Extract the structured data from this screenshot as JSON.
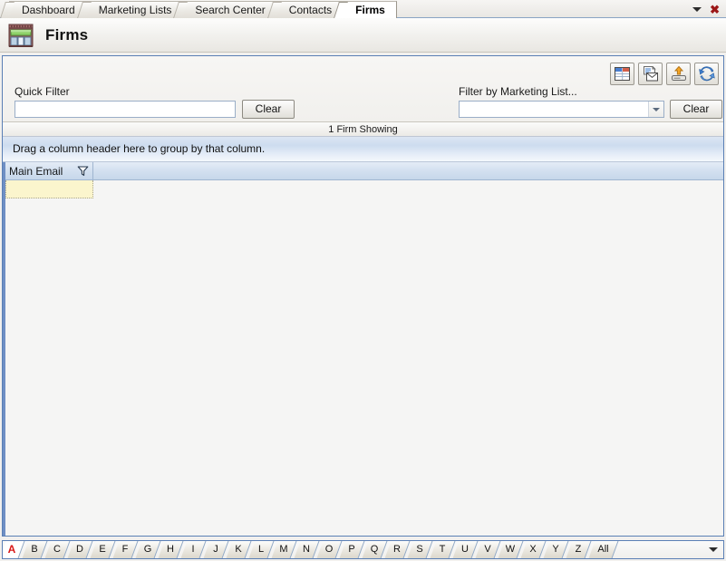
{
  "window": {
    "tabs": [
      {
        "label": "Dashboard",
        "active": false
      },
      {
        "label": "Marketing Lists",
        "active": false
      },
      {
        "label": "Search Center",
        "active": false
      },
      {
        "label": "Contacts",
        "active": false
      },
      {
        "label": "Firms",
        "active": true
      }
    ],
    "tabstrip_menu_icon": "chevron-down-icon",
    "close_icon": "close-icon",
    "close_glyph": "✖"
  },
  "header": {
    "icon": "storefront-icon",
    "title": "Firms"
  },
  "filters": {
    "quick_filter": {
      "label": "Quick Filter",
      "value": "",
      "placeholder": "",
      "clear_label": "Clear"
    },
    "marketing_list": {
      "label": "Filter by Marketing List...",
      "value": "",
      "placeholder": "",
      "clear_label": "Clear",
      "dropdown_icon": "chevron-down-icon"
    }
  },
  "toolbar": {
    "buttons": [
      {
        "name": "grid-view-button",
        "icon": "grid-table-icon"
      },
      {
        "name": "mail-merge-button",
        "icon": "document-envelope-icon"
      },
      {
        "name": "export-button",
        "icon": "upload-arrow-icon"
      },
      {
        "name": "refresh-button",
        "icon": "refresh-circular-arrows-icon"
      }
    ]
  },
  "status": {
    "count_text": "1 Firm Showing"
  },
  "group_bar": {
    "text": "Drag a column header here to group by that column."
  },
  "grid": {
    "columns": [
      {
        "label": "Main Email",
        "filter_icon": "funnel-filter-icon"
      }
    ],
    "filter_row_values": [
      ""
    ],
    "rows": []
  },
  "alpha_bar": {
    "letters": [
      {
        "label": "A",
        "active": true
      },
      {
        "label": "B",
        "active": false
      },
      {
        "label": "C",
        "active": false
      },
      {
        "label": "D",
        "active": false
      },
      {
        "label": "E",
        "active": false
      },
      {
        "label": "F",
        "active": false
      },
      {
        "label": "G",
        "active": false
      },
      {
        "label": "H",
        "active": false
      },
      {
        "label": "I",
        "active": false
      },
      {
        "label": "J",
        "active": false
      },
      {
        "label": "K",
        "active": false
      },
      {
        "label": "L",
        "active": false
      },
      {
        "label": "M",
        "active": false
      },
      {
        "label": "N",
        "active": false
      },
      {
        "label": "O",
        "active": false
      },
      {
        "label": "P",
        "active": false
      },
      {
        "label": "Q",
        "active": false
      },
      {
        "label": "R",
        "active": false
      },
      {
        "label": "S",
        "active": false
      },
      {
        "label": "T",
        "active": false
      },
      {
        "label": "U",
        "active": false
      },
      {
        "label": "V",
        "active": false
      },
      {
        "label": "W",
        "active": false
      },
      {
        "label": "X",
        "active": false
      },
      {
        "label": "Y",
        "active": false
      },
      {
        "label": "Z",
        "active": false
      },
      {
        "label": "All",
        "active": false
      }
    ],
    "overflow_icon": "chevron-down-icon"
  },
  "colors": {
    "panel_border": "#5a7fb5",
    "group_bar_blue": "#cddcef",
    "filter_cell_yellow": "#fbf5cd",
    "active_letter_red": "#d81717",
    "close_red": "#9c1717",
    "grid_left_rail": "#6f8fc4"
  }
}
